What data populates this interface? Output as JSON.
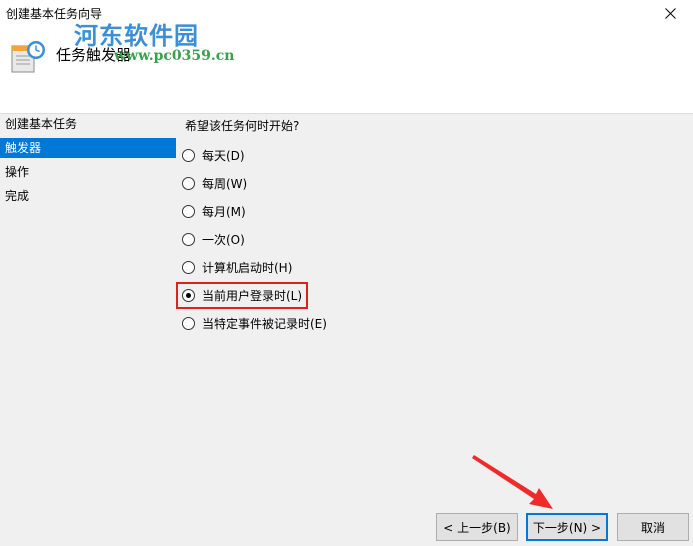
{
  "window": {
    "title": "创建基本任务向导"
  },
  "header": {
    "title": "任务触发器"
  },
  "watermark": {
    "name": "河东软件园",
    "url": "www.pc0359.cn"
  },
  "nav": {
    "items": [
      {
        "label": "创建基本任务",
        "active": false
      },
      {
        "label": "触发器",
        "active": true
      },
      {
        "label": "操作",
        "active": false
      },
      {
        "label": "完成",
        "active": false
      }
    ]
  },
  "trigger": {
    "question": "希望该任务何时开始?",
    "options": [
      {
        "label": "每天(D)",
        "checked": false
      },
      {
        "label": "每周(W)",
        "checked": false
      },
      {
        "label": "每月(M)",
        "checked": false
      },
      {
        "label": "一次(O)",
        "checked": false
      },
      {
        "label": "计算机启动时(H)",
        "checked": false
      },
      {
        "label": "当前用户登录时(L)",
        "checked": true
      },
      {
        "label": "当特定事件被记录时(E)",
        "checked": false
      }
    ]
  },
  "buttons": {
    "back": "< 上一步(B)",
    "next": "下一步(N) >",
    "cancel": "取消"
  },
  "colors": {
    "accent": "#0078d7",
    "highlight": "#e02020"
  }
}
